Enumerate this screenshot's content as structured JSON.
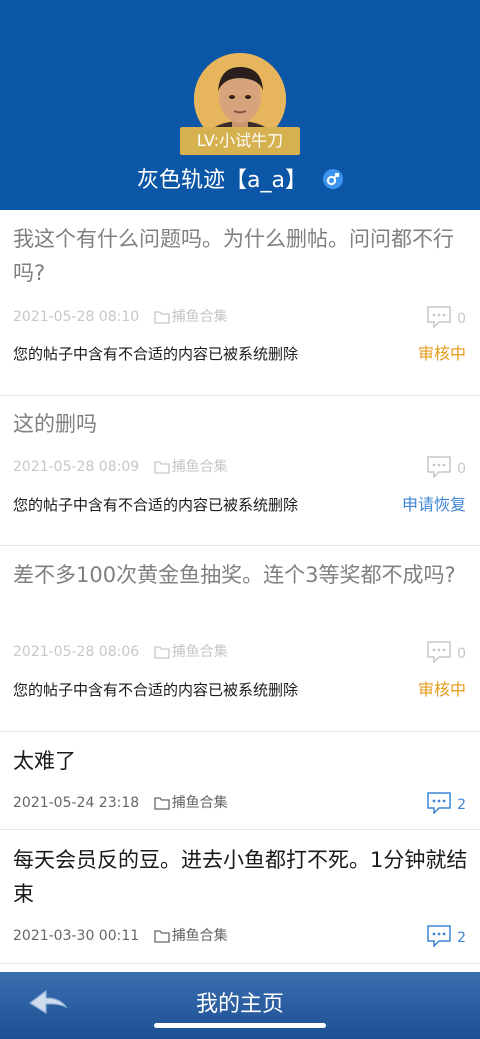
{
  "profile": {
    "level": "LV:小试牛刀",
    "name": "灰色轨迹【a_a】",
    "gender_icon": "male-icon"
  },
  "posts": [
    {
      "title": "我这个有什么问题吗。为什么删帖。问问都不行吗?",
      "date": "2021-05-28 08:10",
      "board": "捕鱼合集",
      "comments": "0",
      "notice": "您的帖子中含有不合适的内容已被系统删除",
      "status": "审核中"
    },
    {
      "title": "这的删吗",
      "date": "2021-05-28 08:09",
      "board": "捕鱼合集",
      "comments": "0",
      "notice": "您的帖子中含有不合适的内容已被系统删除",
      "status": "申请恢复"
    },
    {
      "title": "差不多100次黄金鱼抽奖。连个3等奖都不成吗?",
      "date": "2021-05-28 08:06",
      "board": "捕鱼合集",
      "comments": "0",
      "notice": "您的帖子中含有不合适的内容已被系统删除",
      "status": "审核中"
    },
    {
      "title": "太难了",
      "date": "2021-05-24 23:18",
      "board": "捕鱼合集",
      "comments": "2"
    },
    {
      "title": "每天会员反的豆。进去小鱼都打不死。1分钟就结束",
      "date": "2021-03-30 00:11",
      "board": "捕鱼合集",
      "comments": "2"
    }
  ],
  "bottom_bar": {
    "title": "我的主页",
    "back_icon": "back-arrow-icon"
  },
  "colors": {
    "header_bg": "#0b56a6",
    "badge_bg": "#d5b24f",
    "status_pending": "#e79a1c",
    "status_restore": "#3f85d4"
  }
}
